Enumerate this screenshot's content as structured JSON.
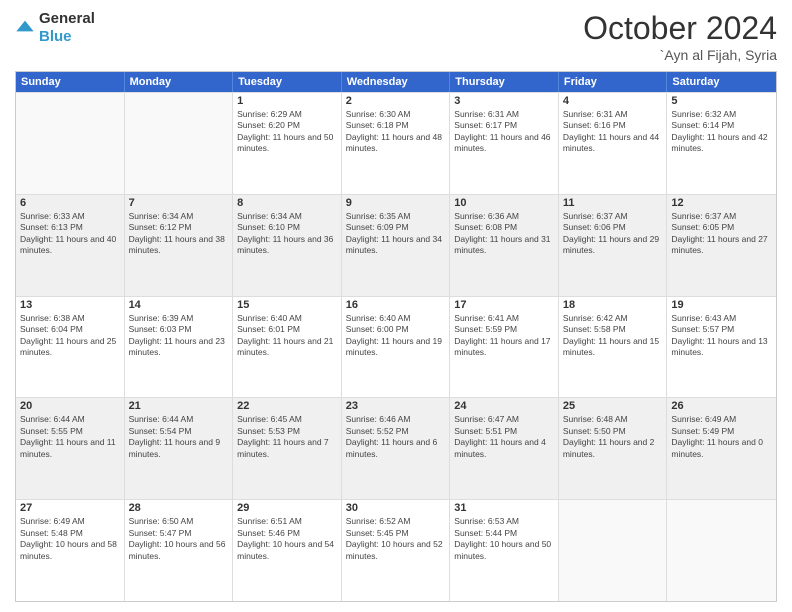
{
  "header": {
    "logo_general": "General",
    "logo_blue": "Blue",
    "month_year": "October 2024",
    "location": "`Ayn al Fijah, Syria"
  },
  "days_of_week": [
    "Sunday",
    "Monday",
    "Tuesday",
    "Wednesday",
    "Thursday",
    "Friday",
    "Saturday"
  ],
  "weeks": [
    [
      {
        "day": "",
        "empty": true
      },
      {
        "day": "",
        "empty": true
      },
      {
        "day": "1",
        "sunrise": "Sunrise: 6:29 AM",
        "sunset": "Sunset: 6:20 PM",
        "daylight": "Daylight: 11 hours and 50 minutes."
      },
      {
        "day": "2",
        "sunrise": "Sunrise: 6:30 AM",
        "sunset": "Sunset: 6:18 PM",
        "daylight": "Daylight: 11 hours and 48 minutes."
      },
      {
        "day": "3",
        "sunrise": "Sunrise: 6:31 AM",
        "sunset": "Sunset: 6:17 PM",
        "daylight": "Daylight: 11 hours and 46 minutes."
      },
      {
        "day": "4",
        "sunrise": "Sunrise: 6:31 AM",
        "sunset": "Sunset: 6:16 PM",
        "daylight": "Daylight: 11 hours and 44 minutes."
      },
      {
        "day": "5",
        "sunrise": "Sunrise: 6:32 AM",
        "sunset": "Sunset: 6:14 PM",
        "daylight": "Daylight: 11 hours and 42 minutes."
      }
    ],
    [
      {
        "day": "6",
        "sunrise": "Sunrise: 6:33 AM",
        "sunset": "Sunset: 6:13 PM",
        "daylight": "Daylight: 11 hours and 40 minutes."
      },
      {
        "day": "7",
        "sunrise": "Sunrise: 6:34 AM",
        "sunset": "Sunset: 6:12 PM",
        "daylight": "Daylight: 11 hours and 38 minutes."
      },
      {
        "day": "8",
        "sunrise": "Sunrise: 6:34 AM",
        "sunset": "Sunset: 6:10 PM",
        "daylight": "Daylight: 11 hours and 36 minutes."
      },
      {
        "day": "9",
        "sunrise": "Sunrise: 6:35 AM",
        "sunset": "Sunset: 6:09 PM",
        "daylight": "Daylight: 11 hours and 34 minutes."
      },
      {
        "day": "10",
        "sunrise": "Sunrise: 6:36 AM",
        "sunset": "Sunset: 6:08 PM",
        "daylight": "Daylight: 11 hours and 31 minutes."
      },
      {
        "day": "11",
        "sunrise": "Sunrise: 6:37 AM",
        "sunset": "Sunset: 6:06 PM",
        "daylight": "Daylight: 11 hours and 29 minutes."
      },
      {
        "day": "12",
        "sunrise": "Sunrise: 6:37 AM",
        "sunset": "Sunset: 6:05 PM",
        "daylight": "Daylight: 11 hours and 27 minutes."
      }
    ],
    [
      {
        "day": "13",
        "sunrise": "Sunrise: 6:38 AM",
        "sunset": "Sunset: 6:04 PM",
        "daylight": "Daylight: 11 hours and 25 minutes."
      },
      {
        "day": "14",
        "sunrise": "Sunrise: 6:39 AM",
        "sunset": "Sunset: 6:03 PM",
        "daylight": "Daylight: 11 hours and 23 minutes."
      },
      {
        "day": "15",
        "sunrise": "Sunrise: 6:40 AM",
        "sunset": "Sunset: 6:01 PM",
        "daylight": "Daylight: 11 hours and 21 minutes."
      },
      {
        "day": "16",
        "sunrise": "Sunrise: 6:40 AM",
        "sunset": "Sunset: 6:00 PM",
        "daylight": "Daylight: 11 hours and 19 minutes."
      },
      {
        "day": "17",
        "sunrise": "Sunrise: 6:41 AM",
        "sunset": "Sunset: 5:59 PM",
        "daylight": "Daylight: 11 hours and 17 minutes."
      },
      {
        "day": "18",
        "sunrise": "Sunrise: 6:42 AM",
        "sunset": "Sunset: 5:58 PM",
        "daylight": "Daylight: 11 hours and 15 minutes."
      },
      {
        "day": "19",
        "sunrise": "Sunrise: 6:43 AM",
        "sunset": "Sunset: 5:57 PM",
        "daylight": "Daylight: 11 hours and 13 minutes."
      }
    ],
    [
      {
        "day": "20",
        "sunrise": "Sunrise: 6:44 AM",
        "sunset": "Sunset: 5:55 PM",
        "daylight": "Daylight: 11 hours and 11 minutes."
      },
      {
        "day": "21",
        "sunrise": "Sunrise: 6:44 AM",
        "sunset": "Sunset: 5:54 PM",
        "daylight": "Daylight: 11 hours and 9 minutes."
      },
      {
        "day": "22",
        "sunrise": "Sunrise: 6:45 AM",
        "sunset": "Sunset: 5:53 PM",
        "daylight": "Daylight: 11 hours and 7 minutes."
      },
      {
        "day": "23",
        "sunrise": "Sunrise: 6:46 AM",
        "sunset": "Sunset: 5:52 PM",
        "daylight": "Daylight: 11 hours and 6 minutes."
      },
      {
        "day": "24",
        "sunrise": "Sunrise: 6:47 AM",
        "sunset": "Sunset: 5:51 PM",
        "daylight": "Daylight: 11 hours and 4 minutes."
      },
      {
        "day": "25",
        "sunrise": "Sunrise: 6:48 AM",
        "sunset": "Sunset: 5:50 PM",
        "daylight": "Daylight: 11 hours and 2 minutes."
      },
      {
        "day": "26",
        "sunrise": "Sunrise: 6:49 AM",
        "sunset": "Sunset: 5:49 PM",
        "daylight": "Daylight: 11 hours and 0 minutes."
      }
    ],
    [
      {
        "day": "27",
        "sunrise": "Sunrise: 6:49 AM",
        "sunset": "Sunset: 5:48 PM",
        "daylight": "Daylight: 10 hours and 58 minutes."
      },
      {
        "day": "28",
        "sunrise": "Sunrise: 6:50 AM",
        "sunset": "Sunset: 5:47 PM",
        "daylight": "Daylight: 10 hours and 56 minutes."
      },
      {
        "day": "29",
        "sunrise": "Sunrise: 6:51 AM",
        "sunset": "Sunset: 5:46 PM",
        "daylight": "Daylight: 10 hours and 54 minutes."
      },
      {
        "day": "30",
        "sunrise": "Sunrise: 6:52 AM",
        "sunset": "Sunset: 5:45 PM",
        "daylight": "Daylight: 10 hours and 52 minutes."
      },
      {
        "day": "31",
        "sunrise": "Sunrise: 6:53 AM",
        "sunset": "Sunset: 5:44 PM",
        "daylight": "Daylight: 10 hours and 50 minutes."
      },
      {
        "day": "",
        "empty": true
      },
      {
        "day": "",
        "empty": true
      }
    ]
  ]
}
